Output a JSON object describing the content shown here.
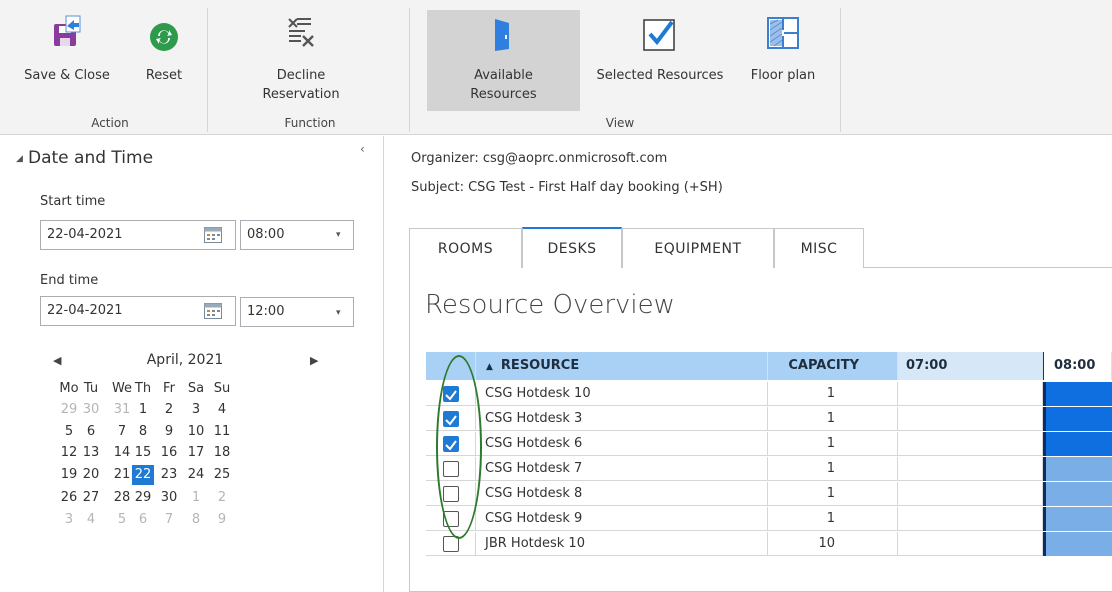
{
  "ribbon": {
    "save_close": "Save & Close",
    "reset": "Reset",
    "decline": "Decline\nReservation",
    "available": "Available\nResources",
    "selected": "Selected Resources",
    "floor": "Floor plan",
    "group_action": "Action",
    "group_function": "Function",
    "group_view": "View"
  },
  "datetime": {
    "section_title": "Date and Time",
    "start_label": "Start time",
    "start_date": "22-04-2021",
    "start_time": "08:00",
    "end_label": "End time",
    "end_date": "22-04-2021",
    "end_time": "12:00"
  },
  "calendar": {
    "month_title": "April, 2021",
    "days": [
      "Mo",
      "Tu",
      "We",
      "Th",
      "Fr",
      "Sa",
      "Su"
    ],
    "weeks": [
      [
        "29",
        "30",
        "31",
        "1",
        "2",
        "3",
        "4"
      ],
      [
        "5",
        "6",
        "7",
        "8",
        "9",
        "10",
        "11"
      ],
      [
        "12",
        "13",
        "14",
        "15",
        "16",
        "17",
        "18"
      ],
      [
        "19",
        "20",
        "21",
        "22",
        "23",
        "24",
        "25"
      ],
      [
        "26",
        "27",
        "28",
        "29",
        "30",
        "1",
        "2"
      ],
      [
        "3",
        "4",
        "5",
        "6",
        "7",
        "8",
        "9"
      ]
    ]
  },
  "meta": {
    "organizer": "Organizer: csg@aoprc.onmicrosoft.com",
    "subject": "Subject: CSG Test - First Half day booking (+SH)"
  },
  "tabs": [
    "ROOMS",
    "DESKS",
    "EQUIPMENT",
    "MISC"
  ],
  "overview_title": "Resource Overview",
  "grid": {
    "col_resource": "RESOURCE",
    "col_capacity": "CAPACITY",
    "col_0700": "07:00",
    "col_0800": "08:00",
    "rows": [
      {
        "name": "CSG Hotdesk 10",
        "capacity": "1",
        "checked": true
      },
      {
        "name": "CSG Hotdesk 3",
        "capacity": "1",
        "checked": true
      },
      {
        "name": "CSG Hotdesk 6",
        "capacity": "1",
        "checked": true
      },
      {
        "name": "CSG Hotdesk 7",
        "capacity": "1",
        "checked": false
      },
      {
        "name": "CSG Hotdesk 8",
        "capacity": "1",
        "checked": false
      },
      {
        "name": "CSG Hotdesk 9",
        "capacity": "1",
        "checked": false
      },
      {
        "name": "JBR Hotdesk 10",
        "capacity": "10",
        "checked": false
      }
    ]
  },
  "colors": {
    "accent": "#1e7ad2",
    "selected_booking": "#0f6fe0",
    "available_booking": "#7aaee6",
    "header": "#a9d1f5",
    "highlight_oval": "#2c7a2c"
  }
}
